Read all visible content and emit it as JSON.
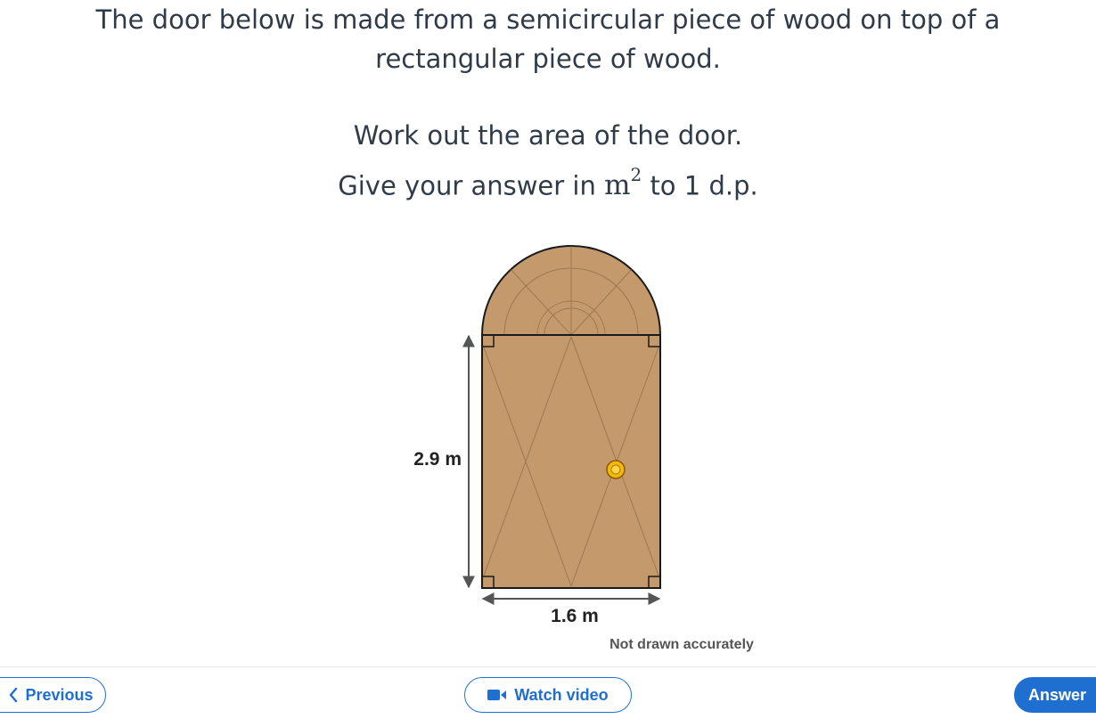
{
  "question": {
    "line1": "The door below is made from a semicircular piece of wood on top of a",
    "line2": "rectangular piece of wood.",
    "line3": "Work out the area of the door.",
    "line4_prefix": "Give your answer in",
    "unit_base": "m",
    "unit_power": "2",
    "line4_suffix": "to 1 d.p."
  },
  "diagram": {
    "height_label": "2.9 m",
    "width_label": "1.6 m",
    "note": "Not drawn accurately",
    "colors": {
      "wood": "#c49a6c",
      "outline": "#1a1a1a",
      "grain": "#8a6a48",
      "knob": "#f2b90f"
    }
  },
  "nav": {
    "previous_label": "Previous",
    "video_label": "Watch video",
    "answer_label": "Answer",
    "accent": "#1f6fd1"
  }
}
